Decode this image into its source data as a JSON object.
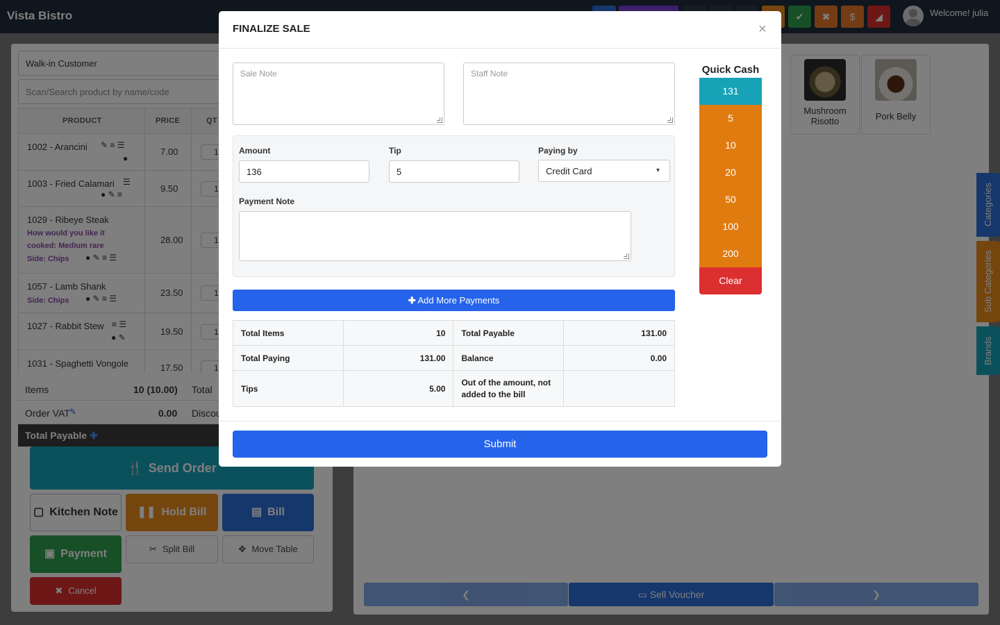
{
  "app": {
    "brand": "Vista Bistro",
    "welcome": "Welcome! julia"
  },
  "colors": {
    "primary": "#2563eb",
    "info": "#17a2b8",
    "warning": "#e07b10",
    "danger": "#dc2f2f",
    "success": "#2e9e4f"
  },
  "pos": {
    "customer": "Walk-in Customer",
    "search_placeholder": "Scan/Search product by name/code",
    "columns": {
      "product": "PRODUCT",
      "price": "PRICE",
      "qty": "QT"
    },
    "items": [
      {
        "name": "1002 - Arancini",
        "price": "7.00",
        "qty": "1"
      },
      {
        "name": "1003 - Fried Calamari",
        "price": "9.50",
        "qty": "1"
      },
      {
        "name": "1029 - Ribeye Steak",
        "mod1": "How would you like it",
        "mod2": "cooked: Medium rare",
        "mod3": "Side: Chips",
        "price": "28.00",
        "qty": "1"
      },
      {
        "name": "1057 - Lamb Shank",
        "mod1": "Side: Chips",
        "price": "23.50",
        "qty": "1"
      },
      {
        "name": "1027 - Rabbit Stew",
        "price": "19.50",
        "qty": "1"
      },
      {
        "name": "1031 - Spaghetti Vongole",
        "price": "17.50",
        "qty": "1"
      }
    ],
    "summary": {
      "items_label": "Items",
      "items_value": "10 (10.00)",
      "total_label": "Total",
      "vat_label": "Order VAT",
      "vat_value": "0.00",
      "discount_label": "Discou",
      "total_payable_label": "Total Payable"
    },
    "actions": {
      "send_order": "Send Order",
      "kitchen_note": "Kitchen Note",
      "hold_bill": "Hold Bill",
      "bill": "Bill",
      "payment": "Payment",
      "split_bill": "Split Bill",
      "move_table": "Move Table",
      "cancel": "Cancel"
    },
    "side_tabs": {
      "categories": "Categories",
      "sub_categories": "Sub Categories",
      "brands": "Brands"
    },
    "products": [
      {
        "name": "Mushroom Risotto"
      },
      {
        "name": "Pork Belly"
      }
    ],
    "nav": {
      "sell_voucher": "Sell Voucher"
    }
  },
  "modal": {
    "title": "FINALIZE SALE",
    "sale_note_placeholder": "Sale Note",
    "staff_note_placeholder": "Staff Note",
    "amount_label": "Amount",
    "amount_value": "136",
    "tip_label": "Tip",
    "tip_value": "5",
    "paying_by_label": "Paying by",
    "paying_by_value": "Credit Card",
    "payment_note_label": "Payment Note",
    "add_more_payments": "Add More Payments",
    "summary": {
      "total_items_label": "Total Items",
      "total_items_value": "10",
      "total_payable_label": "Total Payable",
      "total_payable_value": "131.00",
      "total_paying_label": "Total Paying",
      "total_paying_value": "131.00",
      "balance_label": "Balance",
      "balance_value": "0.00",
      "tips_label": "Tips",
      "tips_value": "5.00",
      "out_of_amount_label": "Out of the amount, not added to the bill"
    },
    "quick_cash": {
      "title": "Quick Cash",
      "values": [
        "131",
        "5",
        "10",
        "20",
        "50",
        "100",
        "200"
      ],
      "clear": "Clear"
    },
    "submit": "Submit"
  }
}
